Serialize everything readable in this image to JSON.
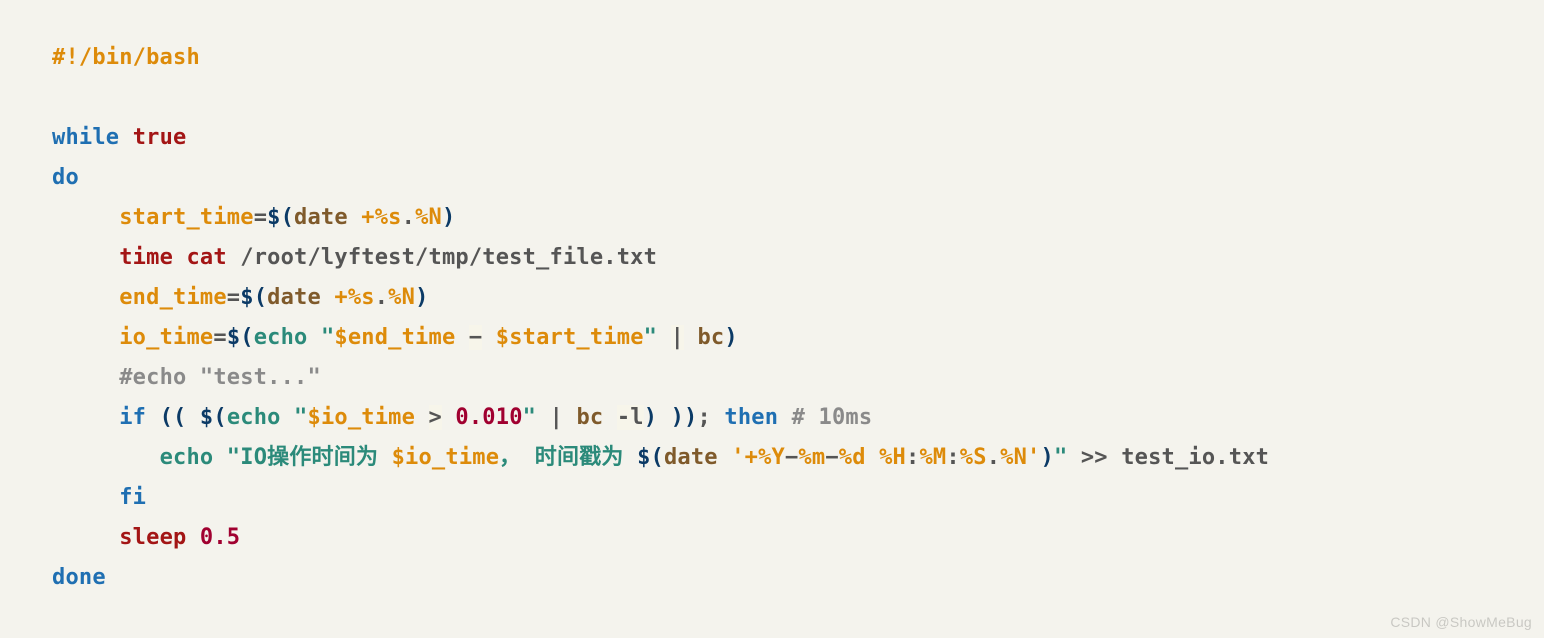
{
  "code": {
    "shebang": "#!/bin/bash",
    "kw_while": "while",
    "kw_true": "true",
    "kw_do": "do",
    "kw_done": "done",
    "kw_if": "if",
    "kw_then": "then",
    "kw_fi": "fi",
    "cmd_time": "time",
    "cmd_cat": "cat",
    "cmd_sleep": "sleep",
    "cmd_echo": "echo",
    "cmd_date": "date",
    "cmd_bc": "bc",
    "var_start_time": "start_time",
    "var_end_time": "end_time",
    "var_io_time": "io_time",
    "var_end_time_ref": "$end_time",
    "var_start_time_ref": "$start_time",
    "var_io_time_ref": "$io_time",
    "fmt_pct_s": "+%s",
    "fmt_dot": ".",
    "fmt_pct_n": "%N",
    "fmt_y": "'+%Y",
    "fmt_m": "%m",
    "fmt_d": "%d",
    "fmt_H": "%H",
    "fmt_M": "%M",
    "fmt_S": "%S",
    "fmt_Nq": "%N'",
    "file_path": "/root/lyftest/tmp/test_file.txt",
    "op_eq": "=",
    "op_gt": ">",
    "op_pipe": "|",
    "op_dash": "-",
    "op_dash2": "−",
    "op_colon": ":",
    "op_redir": ">>",
    "bc_flag": "-l",
    "dquote": "\"",
    "dollar_open": "$(",
    "paren_open2": "((",
    "paren_close": ")",
    "paren_close2": "))",
    "semicolon": ";",
    "comma_cn": "，",
    "num_threshold": "0.010",
    "num_sleep": "0.5",
    "comment_line": "#echo \"test...\"",
    "comment_10ms": "# 10ms",
    "str_io_prefix": "IO操作时间为 ",
    "str_ts_prefix": " 时间戳为 ",
    "out_file": "test_io.txt"
  },
  "watermark": "CSDN @ShowMeBug"
}
